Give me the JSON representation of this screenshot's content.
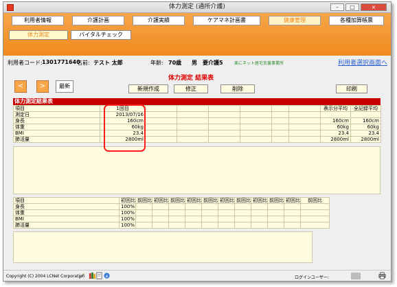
{
  "window": {
    "title": "体力測定 (通所介護)"
  },
  "nav": {
    "top": [
      "利用者情報",
      "介護計画",
      "介護実績",
      "ケアマネ計画書",
      "健康管理",
      "各種加算帳票"
    ],
    "active_index": 4,
    "sub": [
      "体力測定",
      "バイタルチェック"
    ]
  },
  "user": {
    "code_label": "利用者コード:",
    "code": "1301771640",
    "name_label": "名前:",
    "name": "テスト 太郎",
    "age_label": "年齢:",
    "age": "70歳",
    "sex": "男",
    "care_level": "要介護5",
    "office": "楽にネット居宅支援事業所",
    "select_link": "利用者選択画面へ"
  },
  "page": {
    "title": "体力測定 結果表"
  },
  "toolbar": {
    "prev": "<",
    "next": ">",
    "latest": "最新",
    "new": "新規作成",
    "edit": "修正",
    "delete": "削除",
    "print": "印刷"
  },
  "results": {
    "header": "体力測定結果表",
    "col_item": "項目",
    "col_first": "1回目",
    "col_avg": "表示分平均",
    "col_all_avg": "全記録平均",
    "rows": [
      {
        "item": "測定日",
        "first": "2013/07/16",
        "avg": "",
        "all_avg": ""
      },
      {
        "item": "身長",
        "first": "160cm",
        "avg": "160cm",
        "all_avg": "160cm"
      },
      {
        "item": "体重",
        "first": "60kg",
        "avg": "60kg",
        "all_avg": "60kg"
      },
      {
        "item": "BMI",
        "first": "23.4",
        "avg": "23.4",
        "all_avg": "23.4"
      },
      {
        "item": "肺活量",
        "first": "2800ml",
        "avg": "2800ml",
        "all_avg": "2800ml"
      }
    ]
  },
  "comparison": {
    "col_item": "項目",
    "col_a": "初回比",
    "col_b": "前回比",
    "rows": [
      {
        "item": "身長",
        "value": "100%"
      },
      {
        "item": "体重",
        "value": "100%"
      },
      {
        "item": "BMI",
        "value": "100%"
      },
      {
        "item": "肺活量",
        "value": "100%"
      }
    ]
  },
  "status": {
    "copyright": "Copyright (C) 2004 LCNet Corporation",
    "login_label": "ログインユーザー:"
  },
  "colors": {
    "accent_orange": "#f08a1e",
    "header_red": "#c80000",
    "title_red": "#e00000",
    "table_bg": "#fffce0"
  },
  "icons": [
    "app-icon",
    "pen-icon",
    "books-icon",
    "document-icon",
    "ie-icon",
    "printer-icon"
  ]
}
